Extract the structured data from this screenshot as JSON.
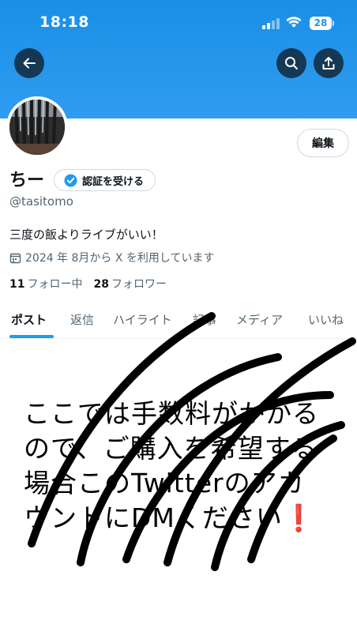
{
  "status_bar": {
    "time": "18:18",
    "battery": "28"
  },
  "profile": {
    "name": "ちー",
    "verify_label": "認証を受ける",
    "handle": "@tasitomo",
    "bio": "三度の飯よりライブがいい！",
    "joined": "2024 年 8月から X を利用しています",
    "following_count": "11",
    "following_label": "フォロー中",
    "followers_count": "28",
    "followers_label": "フォロワー",
    "edit_label": "編集"
  },
  "tabs": [
    {
      "label": "ポスト",
      "active": true
    },
    {
      "label": "返信"
    },
    {
      "label": "ハイライト"
    },
    {
      "label": "記事"
    },
    {
      "label": "メディア"
    },
    {
      "label": "いいね"
    }
  ],
  "overlay": {
    "lines": [
      "ここでは手数料がかかる",
      "ので、ご購入を希望する",
      "場合このTwitterのアカ",
      "ウントにDMください"
    ],
    "emphasis": "❗"
  },
  "colors": {
    "banner": "#1d9bf0",
    "accent": "#1d9bf0",
    "exclaim": "#e0242a"
  }
}
